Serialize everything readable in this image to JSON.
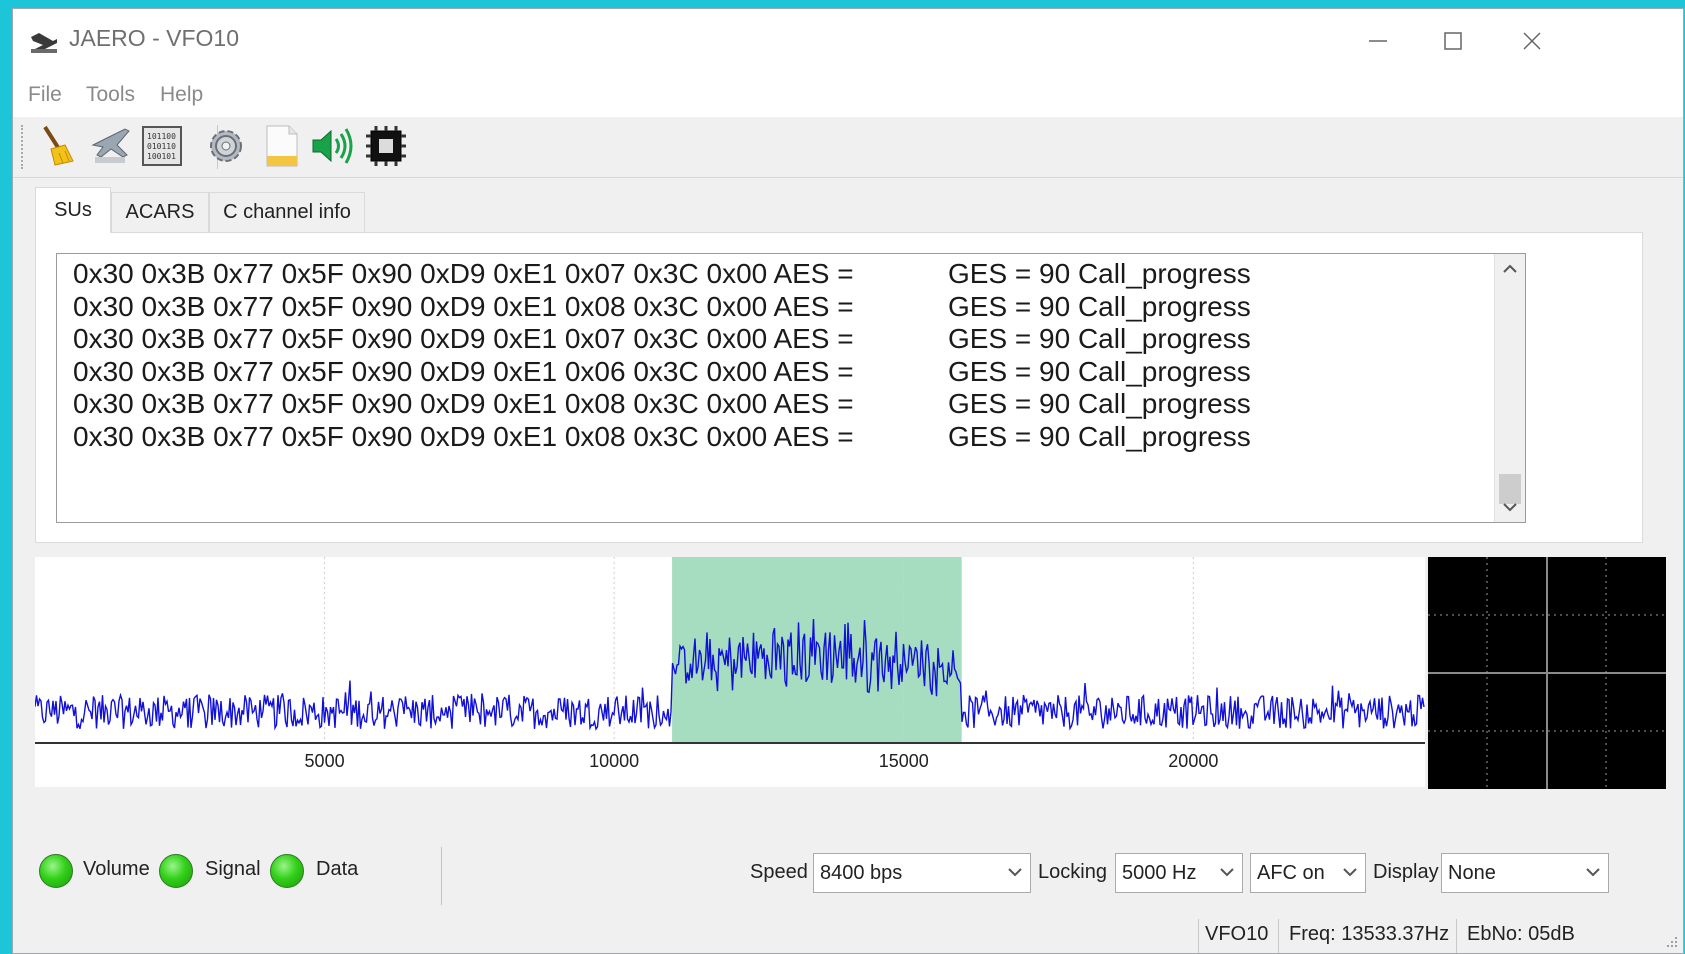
{
  "window": {
    "title": "JAERO - VFO10"
  },
  "menu": {
    "items": [
      "File",
      "Tools",
      "Help"
    ]
  },
  "toolbar": {
    "buttons": [
      "broom-icon",
      "plane-icon",
      "binary-data-icon",
      "gear-icon",
      "log-file-icon",
      "speaker-icon",
      "chip-icon"
    ]
  },
  "tabs": [
    {
      "label": "SUs",
      "active": true
    },
    {
      "label": "ACARS",
      "active": false
    },
    {
      "label": "C channel info",
      "active": false
    }
  ],
  "messages": [
    {
      "hex": "0x30 0x3B 0x77 0x5F 0x90 0xD9 0xE1 0x07 0x3C 0x00 AES =",
      "ges": "GES = 90 Call_progress"
    },
    {
      "hex": "0x30 0x3B 0x77 0x5F 0x90 0xD9 0xE1 0x08 0x3C 0x00 AES =",
      "ges": "GES = 90 Call_progress"
    },
    {
      "hex": "0x30 0x3B 0x77 0x5F 0x90 0xD9 0xE1 0x07 0x3C 0x00 AES =",
      "ges": "GES = 90 Call_progress"
    },
    {
      "hex": "0x30 0x3B 0x77 0x5F 0x90 0xD9 0xE1 0x06 0x3C 0x00 AES =",
      "ges": "GES = 90 Call_progress"
    },
    {
      "hex": "0x30 0x3B 0x77 0x5F 0x90 0xD9 0xE1 0x08 0x3C 0x00 AES =",
      "ges": "GES = 90 Call_progress"
    },
    {
      "hex": "0x30 0x3B 0x77 0x5F 0x90 0xD9 0xE1 0x08 0x3C 0x00 AES =",
      "ges": "GES = 90 Call_progress"
    }
  ],
  "spectrum": {
    "x_ticks": [
      "5000",
      "10000",
      "15000",
      "20000"
    ],
    "x_tick_values": [
      5000,
      10000,
      15000,
      20000
    ],
    "x_range": [
      0,
      24000
    ],
    "highlight_band": [
      11000,
      16000
    ],
    "colors": {
      "trace": "#1010d8",
      "band": "#a6dcbf",
      "grid": "#d0d0d0"
    }
  },
  "indicators": [
    {
      "label": "Volume",
      "state": "on"
    },
    {
      "label": "Signal",
      "state": "on"
    },
    {
      "label": "Data",
      "state": "on"
    }
  ],
  "controls": {
    "speed_label": "Speed",
    "speed_value": "8400 bps",
    "locking_label": "Locking",
    "locking_value": "5000 Hz",
    "afc_value": "AFC on",
    "display_label": "Display",
    "display_value": "None"
  },
  "statusbar": {
    "vfo": "VFO10",
    "freq": "Freq: 13533.37Hz",
    "ebno": "EbNo: 05dB"
  }
}
